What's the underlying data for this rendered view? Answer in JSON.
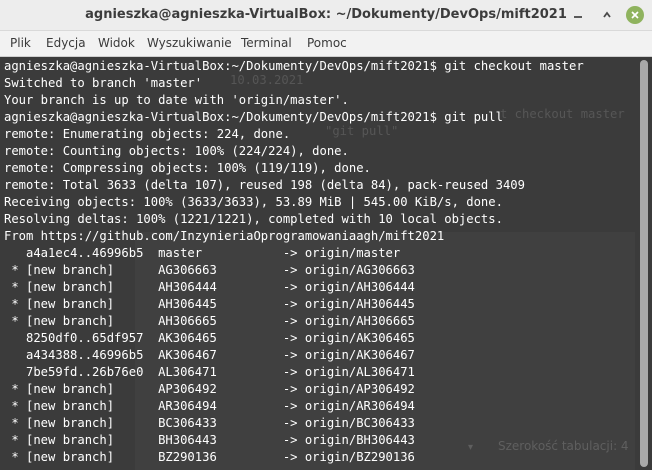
{
  "window": {
    "title": "agnieszka@agnieszka-VirtualBox: ~/Dokumenty/DevOps/mift2021"
  },
  "menu": {
    "items": [
      "Plik",
      "Edycja",
      "Widok",
      "Wyszukiwanie",
      "Terminal",
      "Pomoc"
    ]
  },
  "terminal": {
    "lines": [
      "agnieszka@agnieszka-VirtualBox:~/Dokumenty/DevOps/mift2021$ git checkout master",
      "Switched to branch 'master'",
      "Your branch is up to date with 'origin/master'.",
      "agnieszka@agnieszka-VirtualBox:~/Dokumenty/DevOps/mift2021$ git pull",
      "remote: Enumerating objects: 224, done.",
      "remote: Counting objects: 100% (224/224), done.",
      "remote: Compressing objects: 100% (119/119), done.",
      "remote: Total 3633 (delta 107), reused 198 (delta 84), pack-reused 3409",
      "Receiving objects: 100% (3633/3633), 53.89 MiB | 545.00 KiB/s, done.",
      "Resolving deltas: 100% (1221/1221), completed with 10 local objects.",
      "From https://github.com/InzynieriaOprogramowaniaagh/mift2021",
      "   a4a1ec4..46996b5  master           -> origin/master",
      " * [new branch]      AG306663         -> origin/AG306663",
      " * [new branch]      AH306444         -> origin/AH306444",
      " * [new branch]      AH306445         -> origin/AH306445",
      " * [new branch]      AH306665         -> origin/AH306665",
      "   8250df0..65df957  AK306465         -> origin/AK306465",
      "   a434388..46996b5  AK306467         -> origin/AK306467",
      "   7be59fd..26b76e0  AL306471         -> origin/AL306471",
      " * [new branch]      AP306492         -> origin/AP306492",
      " * [new branch]      AR306494         -> origin/AR306494",
      " * [new branch]      BC306433         -> origin/BC306433",
      " * [new branch]      BH306443         -> origin/BH306443",
      " * [new branch]      BZ290136         -> origin/BZ290136"
    ]
  },
  "ghost": {
    "date_text": "10.03.2021",
    "checkout_text": "t checkout master",
    "pull_text": "\"git pull\"",
    "status_text": "Szerokość tabulacji: 4"
  },
  "colors": {
    "terminal_bg": "#3b3b3b",
    "terminal_fg": "#ffffff",
    "titlebar_bg": "#ededed",
    "close_button": "#8fb35e"
  }
}
